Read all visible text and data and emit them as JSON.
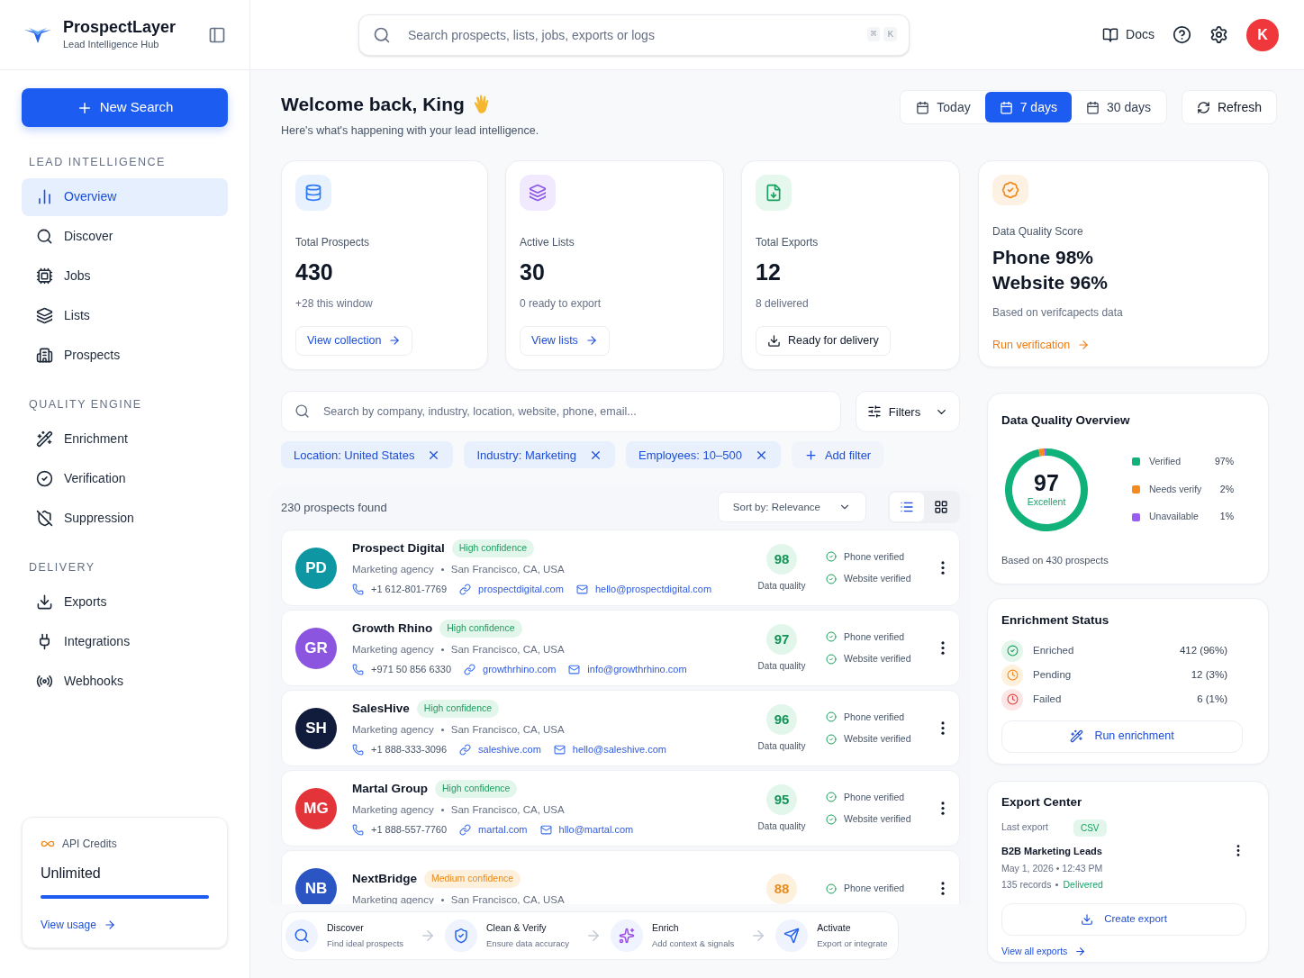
{
  "app": {
    "name": "ProspectLayer",
    "tagline": "Lead Intelligence Hub"
  },
  "search": {
    "placeholder": "Search prospects, lists, jobs, exports or logs",
    "shortcut_keys": [
      "⌘",
      "K"
    ]
  },
  "header": {
    "docs": "Docs",
    "avatar": "K"
  },
  "sidebar": {
    "new_search": "New Search",
    "sections": [
      {
        "title": "LEAD INTELLIGENCE",
        "items": [
          {
            "label": "Overview",
            "selected": true
          },
          {
            "label": "Discover",
            "selected": false
          },
          {
            "label": "Jobs",
            "selected": false
          },
          {
            "label": "Lists",
            "selected": false
          },
          {
            "label": "Prospects",
            "selected": false
          }
        ]
      },
      {
        "title": "QUALITY ENGINE",
        "items": [
          {
            "label": "Enrichment",
            "selected": false
          },
          {
            "label": "Verification",
            "selected": false
          },
          {
            "label": "Suppression",
            "selected": false
          }
        ]
      },
      {
        "title": "DELIVERY",
        "items": [
          {
            "label": "Exports",
            "selected": false
          },
          {
            "label": "Integrations",
            "selected": false
          },
          {
            "label": "Webhooks",
            "selected": false
          }
        ]
      }
    ],
    "credits": {
      "title": "API Credits",
      "value": "Unlimited",
      "level": 1,
      "link": "View usage"
    }
  },
  "greeting": {
    "title": "Welcome back, King",
    "subtitle": "Here's what's happening with your lead intelligence."
  },
  "ranges": [
    {
      "label": "Today",
      "selected": false
    },
    {
      "label": "7 days",
      "selected": true
    },
    {
      "label": "30 days",
      "selected": false
    }
  ],
  "refresh": "Refresh",
  "stats": [
    {
      "label": "Total Prospects",
      "value": "430",
      "note": "+28 this window",
      "action": "View collection",
      "kind": "link"
    },
    {
      "label": "Active Lists",
      "value": "30",
      "note": "0 ready to export",
      "action": "View lists",
      "kind": "link"
    },
    {
      "label": "Total Exports",
      "value": "12",
      "note": "8 delivered",
      "action": "Ready for delivery",
      "kind": "download"
    }
  ],
  "quality_score": {
    "label": "Data Quality Score",
    "lines": [
      "Phone 98%",
      "Website 96%"
    ],
    "note": "Based on verifcapects data",
    "action": "Run verification"
  },
  "prospect_search": {
    "placeholder": "Search by company, industry, location, website, phone, email...",
    "filters": "Filters",
    "chips": [
      "Location: United States",
      "Industry: Marketing",
      "Employees: 10–500"
    ],
    "add_filter": "Add filter"
  },
  "results": {
    "count": "230 prospects found",
    "sort": "Sort by: Relevance",
    "views": [
      {
        "kind": "list",
        "selected": true
      },
      {
        "kind": "grid",
        "selected": false
      }
    ],
    "prospects": [
      {
        "initials": "PD",
        "color": "#0e97a3",
        "name": "Prospect Digital",
        "confidence": "High confidence",
        "kind": "high",
        "type": "Marketing agency",
        "location": "San Francisco, CA, USA",
        "phone": "+1 612-801-7769",
        "website": "prospectdigital.com",
        "email": "hello@prospectdigital.com",
        "score": "98",
        "score_label": "Data quality",
        "checks": [
          "Phone verified",
          "Website verified"
        ]
      },
      {
        "initials": "GR",
        "color": "#8b55e0",
        "name": "Growth Rhino",
        "confidence": "High confidence",
        "kind": "high",
        "type": "Marketing agency",
        "location": "San Francisco, CA, USA",
        "phone": "+971 50 856 6330",
        "website": "growthrhino.com",
        "email": "info@growthrhino.com",
        "score": "97",
        "score_label": "Data quality",
        "checks": [
          "Phone verified",
          "Website verified"
        ]
      },
      {
        "initials": "SH",
        "color": "#111b3b",
        "name": "SalesHive",
        "confidence": "High confidence",
        "kind": "high",
        "type": "Marketing agency",
        "location": "San Francisco, CA, USA",
        "phone": "+1 888-333-3096",
        "website": "saleshive.com",
        "email": "hello@saleshive.com",
        "score": "96",
        "score_label": "Data quality",
        "checks": [
          "Phone verified",
          "Website verified"
        ]
      },
      {
        "initials": "MG",
        "color": "#e3343a",
        "name": "Martal Group",
        "confidence": "High confidence",
        "kind": "high",
        "type": "Marketing agency",
        "location": "San Francisco, CA, USA",
        "phone": "+1 888-557-7760",
        "website": "martal.com",
        "email": "hllo@martal.com",
        "score": "95",
        "score_label": "Data quality",
        "checks": [
          "Phone verified",
          "Website verified"
        ]
      },
      {
        "initials": "NB",
        "color": "#2c55c4",
        "name": "NextBridge",
        "confidence": "Medium confidence",
        "kind": "medium",
        "type": "Marketing agency",
        "location": "San Francisco, CA, USA",
        "score": "88",
        "checks": [
          "Phone verified"
        ]
      }
    ]
  },
  "pipeline": [
    {
      "title": "Discover",
      "subtitle": "Find ideal prospects"
    },
    {
      "title": "Clean & Verify",
      "subtitle": "Ensure data accuracy"
    },
    {
      "title": "Enrich",
      "subtitle": "Add context & signals"
    },
    {
      "title": "Activate",
      "subtitle": "Export or integrate"
    }
  ],
  "overview": {
    "title": "Data Quality Overview",
    "score": "97",
    "rating": "Excellent",
    "footnote": "Based on 430 prospects",
    "chart_data": {
      "type": "donut",
      "categories": [
        "Verified",
        "Needs verify",
        "Unavailable"
      ],
      "values": [
        97,
        2,
        1
      ],
      "value_labels": [
        "97%",
        "2%",
        "1%"
      ],
      "colors": [
        "#10b27a",
        "#f58a1f",
        "#9a5cf2"
      ]
    }
  },
  "enrichment": {
    "title": "Enrichment Status",
    "rows": [
      {
        "label": "Enriched",
        "value": "412 (96%)",
        "kind": "done"
      },
      {
        "label": "Pending",
        "value": "12 (3%)",
        "kind": "pending"
      },
      {
        "label": "Failed",
        "value": "6 (1%)",
        "kind": "failed"
      }
    ],
    "action": "Run enrichment"
  },
  "export_center": {
    "title": "Export Center",
    "last_label": "Last export",
    "format": "CSV",
    "name": "B2B Marketing Leads",
    "date": "May 1, 2026 • 12:43 PM",
    "records": "135 records",
    "status": "Delivered",
    "action": "Create export",
    "link": "View all exports"
  }
}
